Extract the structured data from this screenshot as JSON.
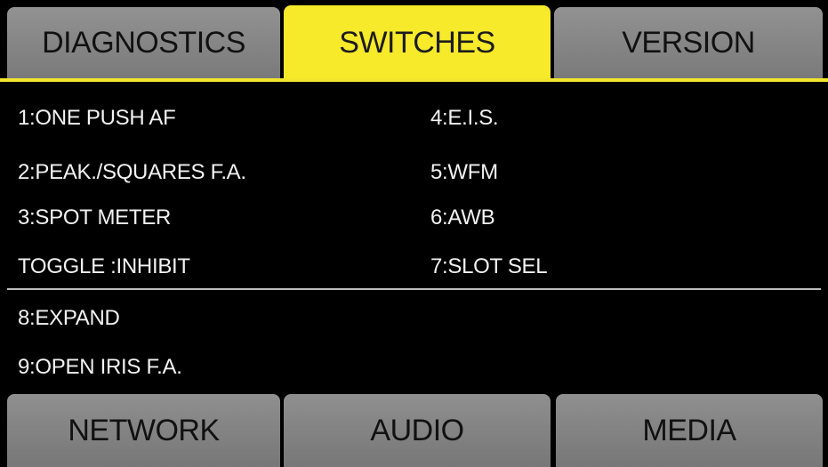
{
  "top_tabs": {
    "diagnostics": "DIAGNOSTICS",
    "switches": "SWITCHES",
    "version": "VERSION"
  },
  "switches": {
    "left": [
      "1:ONE PUSH AF",
      "2:PEAK./SQUARES F.A.",
      "3:SPOT METER",
      "TOGGLE  :INHIBIT"
    ],
    "right": [
      "4:E.I.S.",
      "5:WFM",
      "6:AWB",
      "7:SLOT SEL"
    ],
    "lower": [
      "8:EXPAND",
      "9:OPEN IRIS F.A."
    ]
  },
  "bottom_tabs": {
    "network": "NETWORK",
    "audio": "AUDIO",
    "media": "MEDIA"
  },
  "colors": {
    "active_tab": "#f6ea2a",
    "inactive_tab": "#8a8a8a",
    "background": "#000000",
    "text": "#f2f2f2"
  }
}
